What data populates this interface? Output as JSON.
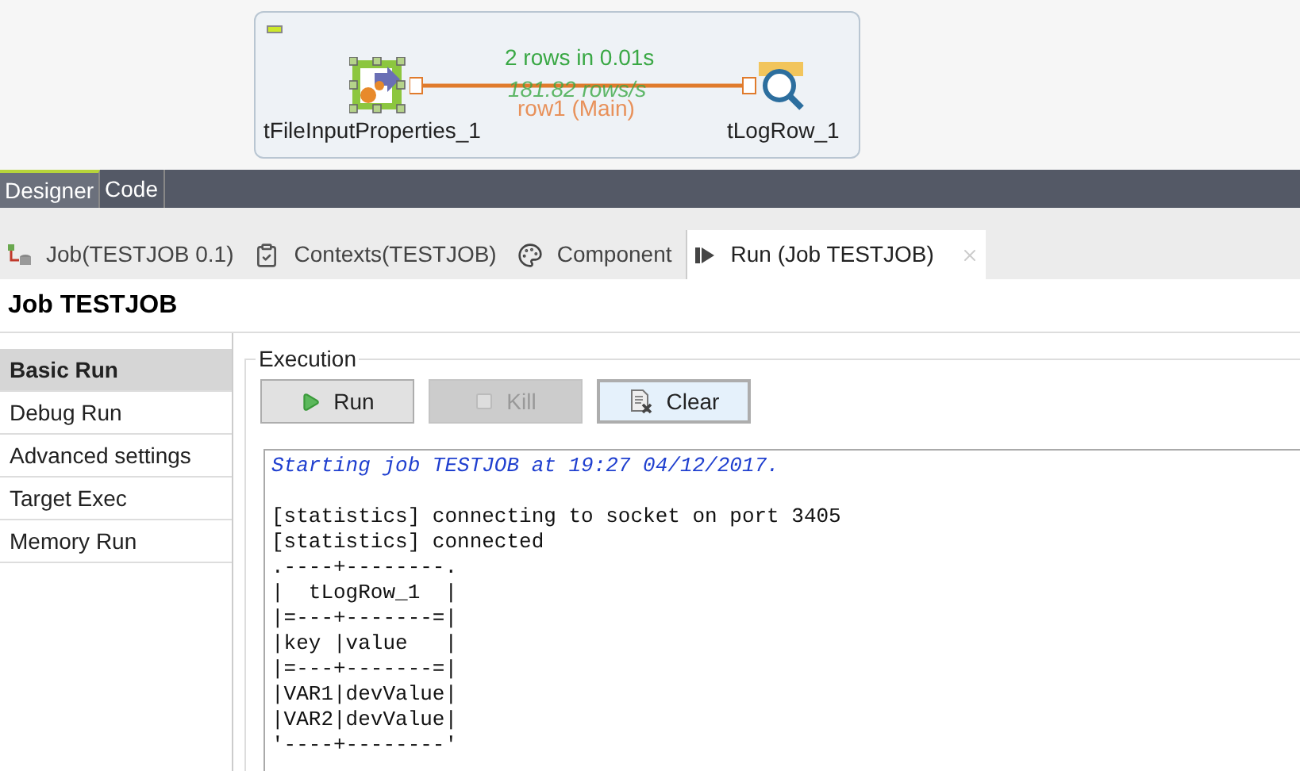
{
  "canvas": {
    "nodes": [
      {
        "label": "tFileInputProperties_1",
        "kind": "input",
        "selected": true
      },
      {
        "label": "tLogRow_1",
        "kind": "log",
        "selected": false
      }
    ],
    "link": {
      "stats": "2 rows in 0.01s",
      "rate": "181.82 rows/s",
      "label": "row1 (Main)"
    }
  },
  "editor_tabs": [
    {
      "label": "Designer",
      "selected": true
    },
    {
      "label": "Code",
      "selected": false
    }
  ],
  "view_tabs": [
    {
      "label": "Job(TESTJOB 0.1)",
      "kind": "job",
      "selected": false
    },
    {
      "label": "Contexts(TESTJOB)",
      "kind": "contexts",
      "selected": false
    },
    {
      "label": "Component",
      "kind": "component",
      "selected": false
    },
    {
      "label": "Run (Job TESTJOB)",
      "kind": "run",
      "selected": true
    }
  ],
  "title": "Job TESTJOB",
  "sidebar": {
    "items": [
      {
        "label": "Basic Run",
        "selected": true
      },
      {
        "label": "Debug Run",
        "selected": false
      },
      {
        "label": "Advanced settings",
        "selected": false
      },
      {
        "label": "Target Exec",
        "selected": false
      },
      {
        "label": "Memory Run",
        "selected": false
      }
    ]
  },
  "execution": {
    "legend": "Execution",
    "buttons": [
      {
        "label": "Run",
        "kind": "run",
        "disabled": false,
        "focused": false
      },
      {
        "label": "Kill",
        "kind": "kill",
        "disabled": true,
        "focused": false
      },
      {
        "label": "Clear",
        "kind": "clear",
        "disabled": false,
        "focused": true
      }
    ],
    "console": [
      {
        "kind": "info",
        "text": "Starting job TESTJOB at 19:27 04/12/2017."
      },
      {
        "kind": "output",
        "text": "[statistics] connecting to socket on port 3405"
      },
      {
        "kind": "output",
        "text": "[statistics] connected"
      },
      {
        "kind": "output",
        "text": ".----+--------."
      },
      {
        "kind": "output",
        "text": "|  tLogRow_1  |"
      },
      {
        "kind": "output",
        "text": "|=---+-------=|"
      },
      {
        "kind": "output",
        "text": "|key |value   |"
      },
      {
        "kind": "output",
        "text": "|=---+-------=|"
      },
      {
        "kind": "output",
        "text": "|VAR1|devValue|"
      },
      {
        "kind": "output",
        "text": "|VAR2|devValue|"
      },
      {
        "kind": "output",
        "text": "'----+--------'"
      }
    ]
  }
}
